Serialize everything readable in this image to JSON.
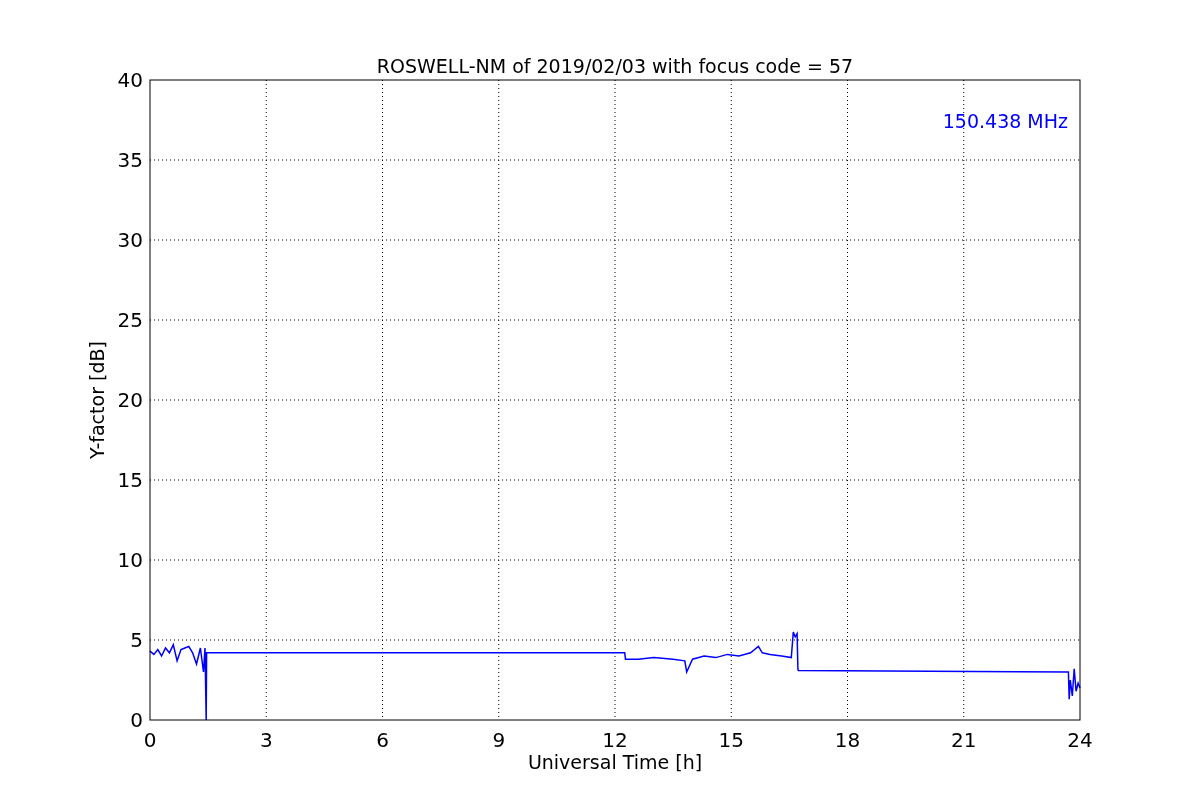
{
  "chart_data": {
    "type": "line",
    "title": "ROSWELL-NM of 2019/02/03 with focus code = 57",
    "xlabel": "Universal Time [h]",
    "ylabel": "Y-factor [dB]",
    "x": [
      0,
      0.1,
      0.2,
      0.3,
      0.4,
      0.5,
      0.6,
      0.7,
      0.8,
      0.9,
      1.0,
      1.1,
      1.2,
      1.3,
      1.38,
      1.42,
      1.45,
      1.46,
      1.47,
      12.25,
      12.27,
      12.6,
      13.0,
      13.5,
      13.8,
      13.85,
      14.0,
      14.3,
      14.6,
      14.9,
      15.2,
      15.5,
      15.7,
      15.8,
      16.0,
      16.3,
      16.55,
      16.6,
      16.65,
      16.7,
      16.72,
      16.73,
      23.7,
      23.72,
      23.75,
      23.8,
      23.85,
      23.9,
      23.95,
      24
    ],
    "series": [
      {
        "name": "150.438 MHz",
        "color": "#0000ff",
        "values": [
          4.3,
          4.1,
          4.4,
          4.0,
          4.5,
          4.2,
          4.7,
          3.7,
          4.4,
          4.5,
          4.6,
          4.2,
          3.5,
          4.5,
          3.0,
          4.5,
          0,
          4.2,
          4.2,
          4.2,
          3.8,
          3.8,
          3.9,
          3.8,
          3.7,
          3.0,
          3.8,
          4.0,
          3.9,
          4.1,
          4.0,
          4.2,
          4.6,
          4.2,
          4.1,
          4.0,
          3.9,
          5.5,
          5.2,
          5.4,
          3.2,
          3.1,
          3.0,
          1.3,
          2.5,
          1.5,
          3.2,
          1.8,
          2.3,
          2.0
        ]
      }
    ],
    "xlim": [
      0,
      24
    ],
    "ylim": [
      0,
      40
    ],
    "xticks": [
      0,
      3,
      6,
      9,
      12,
      15,
      18,
      21,
      24
    ],
    "yticks": [
      0,
      5,
      10,
      15,
      20,
      25,
      30,
      35,
      40
    ],
    "grid": true
  }
}
